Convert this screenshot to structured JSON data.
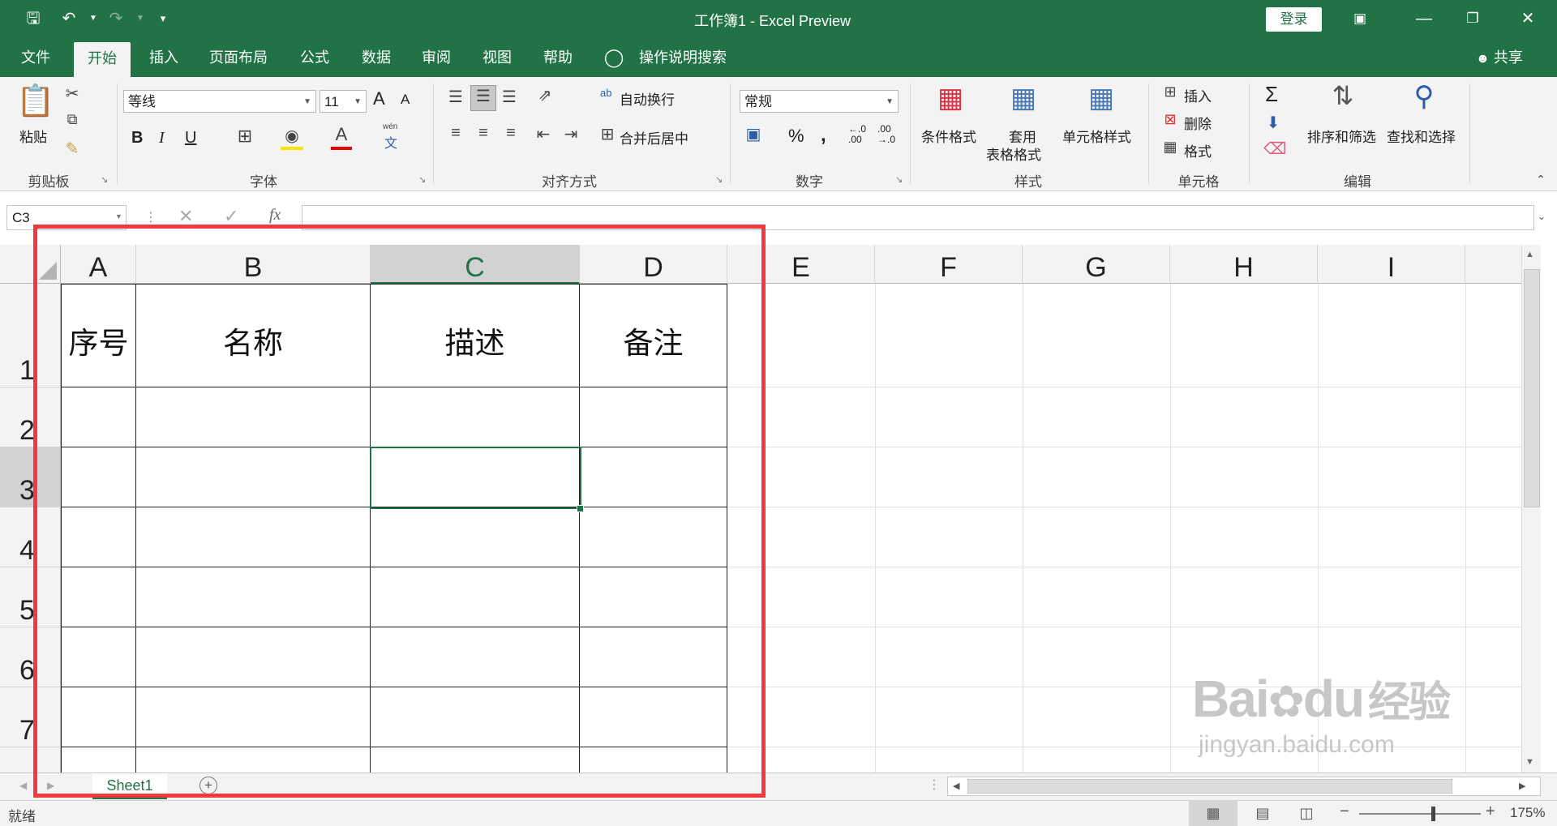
{
  "titlebar": {
    "title": "工作簿1 -  Excel Preview",
    "login_label": "登录"
  },
  "tabs": [
    "文件",
    "开始",
    "插入",
    "页面布局",
    "公式",
    "数据",
    "审阅",
    "视图",
    "帮助"
  ],
  "active_tab": "开始",
  "tell_me": "操作说明搜索",
  "share_label": "共享",
  "ribbon": {
    "clipboard": {
      "paste": "粘贴",
      "label": "剪贴板"
    },
    "font": {
      "name": "等线",
      "size": "11",
      "grow": "A",
      "shrink": "A",
      "bold": "B",
      "italic": "I",
      "underline": "U",
      "label": "字体",
      "phonetic_top": "wén",
      "phonetic_bottom": "文"
    },
    "align": {
      "wrap": "自动换行",
      "merge": "合并后居中",
      "label": "对齐方式",
      "wrap_icon": "ab"
    },
    "number": {
      "format": "常规",
      "percent": "%",
      "comma": ",",
      "label": "数字",
      "inc": "←.0\n.00",
      "dec": ".00\n→.0"
    },
    "styles": {
      "cond": "条件格式",
      "table_top": "套用",
      "table_bottom": "表格格式",
      "cell": "单元格样式",
      "label": "样式"
    },
    "cells": {
      "insert": "插入",
      "delete": "删除",
      "format": "格式",
      "label": "单元格"
    },
    "editing": {
      "sort": "排序和筛选",
      "find": "查找和选择",
      "label": "编辑",
      "sum": "Σ"
    }
  },
  "formula_bar": {
    "namebox": "C3",
    "fx": "fx",
    "content": ""
  },
  "columns": [
    "A",
    "B",
    "C",
    "D",
    "E",
    "F",
    "G",
    "H",
    "I"
  ],
  "selected_column": "C",
  "rows": [
    "1",
    "2",
    "3",
    "4",
    "5",
    "6",
    "7"
  ],
  "selected_row": "3",
  "table": {
    "headers": [
      "序号",
      "名称",
      "描述",
      "备注"
    ]
  },
  "sheet_tab": "Sheet1",
  "status": {
    "ready": "就绪",
    "zoom": "175%"
  },
  "watermark": {
    "brand": "Bai",
    "brand2": "du",
    "brand_cn": "经验",
    "url": "jingyan.baidu.com"
  },
  "colors": {
    "accent": "#217346",
    "highlight_box": "#f03a3e"
  }
}
